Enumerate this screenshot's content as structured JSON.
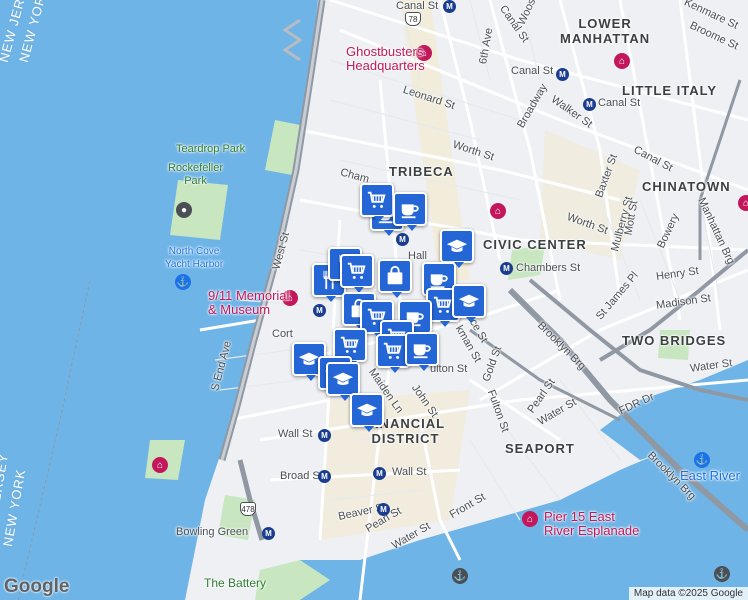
{
  "map": {
    "water_color": "#6fb4e6",
    "land_color": "#eef0f3",
    "park_color": "#c8e6c0",
    "highway_color": "#8f98a3",
    "pin_color": "#2466d6"
  },
  "neighborhoods": {
    "lower_manhattan": "LOWER\nMANHATTAN",
    "tribeca": "TRIBECA",
    "little_italy": "LITTLE ITALY",
    "chinatown": "CHINATOWN",
    "civic_center": "CIVIC CENTER",
    "two_bridges": "TWO BRIDGES",
    "seaport": "SEAPORT",
    "financial_district": "FINANCIAL\nDISTRICT",
    "new_jersey": "NEW JERSEY",
    "new_york_left": "NEW YORK",
    "new_jersey_bottom": "NEW JERSEY",
    "new_york_bottom": "NEW YORK"
  },
  "pois": {
    "ghostbusters": "Ghostbusters\nHeadquarters",
    "memorial": "9/11 Memorial\n& Museum",
    "pier15": "Pier 15 East\nRiver Esplanade",
    "teardrop": "Teardrop Park",
    "rockefeller": "Rockefeller\nPark",
    "north_cove": "North Cove\nYacht Harbor",
    "battery": "The Battery",
    "east_river": "East River"
  },
  "streets": {
    "canal_st_1": "Canal St",
    "canal_st_2": "Canal St",
    "canal_st_3": "Canal St",
    "canal_st_4": "Canal St",
    "canal_st_5": "Canal St",
    "sixth_ave": "6th Ave",
    "leonard": "Leonard St",
    "broadway": "Broadway",
    "walker": "Walker St",
    "worth_1": "Worth St",
    "worth_2": "Worth St",
    "baxter": "Baxter St",
    "kenmare": "Kenmare St",
    "broome": "Broome St",
    "mulberry": "Mulberry St",
    "mott": "Mott St",
    "bowery": "Bowery",
    "manhattan_brg": "Manhattan Brg",
    "chambers_1": "Chambers St",
    "chambers_2": "Chambers St",
    "henry": "Henry St",
    "madison": "Madison St",
    "st_james": "St James Pl",
    "brooklyn_brg": "Brooklyn Brg",
    "water_1": "Water St",
    "water_2": "Water St",
    "water_3": "Water St",
    "fdr": "FDR Dr",
    "pearl_1": "Pearl St",
    "pearl_2": "Pearl St",
    "gold": "Gold St",
    "fulton_1": "Fulton St",
    "fulton_2": "ulton St",
    "john": "John St",
    "maiden": "Maiden Ln",
    "wall_1": "Wall St",
    "wall_2": "Wall St",
    "broad": "Broad St",
    "beaver": "Beaver St",
    "front": "Front St",
    "bowling_green": "Bowling Green",
    "s_end_ave": "S End Ave",
    "west_st": "West St",
    "cort": "Cort",
    "hall": "Hall",
    "chamb_partial": "Cham",
    "woos": "Woos",
    "ce_st": "ce St",
    "kman_st": "kman St",
    "brooklyn_brg_2": "Brooklyn Brg"
  },
  "shields": {
    "i78": "78",
    "i478": "478"
  },
  "pins": [
    {
      "kind": "coffee"
    },
    {
      "kind": "shopping-cart"
    },
    {
      "kind": "coffee"
    },
    {
      "kind": "graduation-cap"
    },
    {
      "kind": "restaurant"
    },
    {
      "kind": "restaurant"
    },
    {
      "kind": "shopping-cart"
    },
    {
      "kind": "shopping-bag"
    },
    {
      "kind": "coffee"
    },
    {
      "kind": "shopping-cart"
    },
    {
      "kind": "shopping-bag"
    },
    {
      "kind": "shopping-cart"
    },
    {
      "kind": "graduation-cap"
    },
    {
      "kind": "coffee"
    },
    {
      "kind": "shopping-cart"
    },
    {
      "kind": "graduation-cap"
    },
    {
      "kind": "shopping-cart"
    },
    {
      "kind": "shopping-cart"
    },
    {
      "kind": "coffee"
    },
    {
      "kind": "graduation-cap"
    },
    {
      "kind": "graduation-cap"
    },
    {
      "kind": "graduation-cap"
    }
  ],
  "logo": "Google",
  "attribution": "Map data ©2025 Google"
}
